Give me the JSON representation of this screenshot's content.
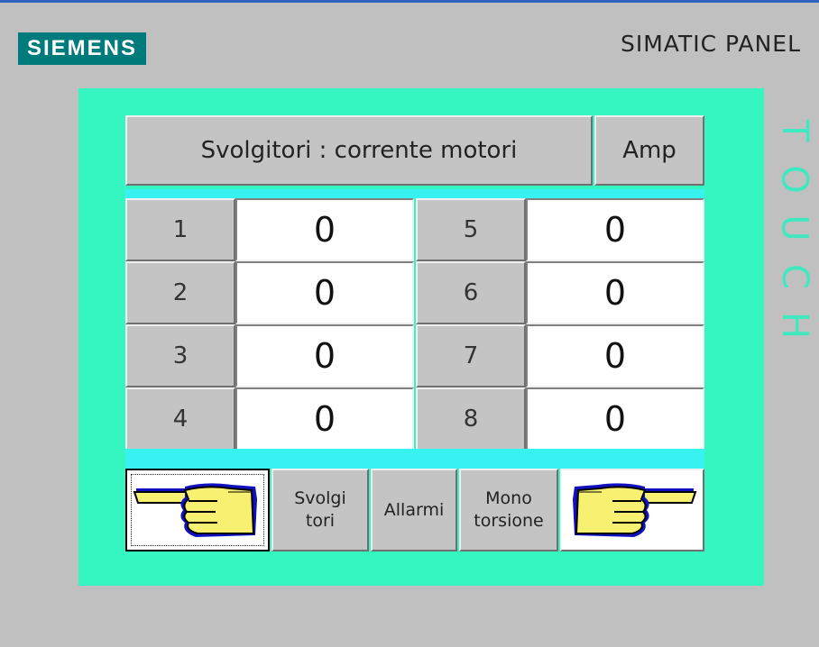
{
  "device": {
    "brand": "SIEMENS",
    "panel_label": "SIMATIC PANEL",
    "touch_label": "TOUCH"
  },
  "screen": {
    "title": "Svolgitori : corrente motori",
    "unit": "Amp",
    "rows": [
      {
        "left_index": "1",
        "left_value": "0",
        "right_index": "5",
        "right_value": "0"
      },
      {
        "left_index": "2",
        "left_value": "0",
        "right_index": "6",
        "right_value": "0"
      },
      {
        "left_index": "3",
        "left_value": "0",
        "right_index": "7",
        "right_value": "0"
      },
      {
        "left_index": "4",
        "left_value": "0",
        "right_index": "8",
        "right_value": "0"
      }
    ],
    "nav": {
      "prev_icon": "hand-pointing-left-icon",
      "svolgitori_line1": "Svolgi",
      "svolgitori_line2": "tori",
      "allarmi": "Allarmi",
      "mono_line1": "Mono",
      "mono_line2": "torsione",
      "next_icon": "hand-pointing-right-icon"
    }
  },
  "colors": {
    "bezel": "#c0c0c0",
    "screen_bg": "#35f5c0",
    "strip": "#38f2f2",
    "logo_bg": "#007b7b",
    "touch_text": "#40e8c0"
  }
}
